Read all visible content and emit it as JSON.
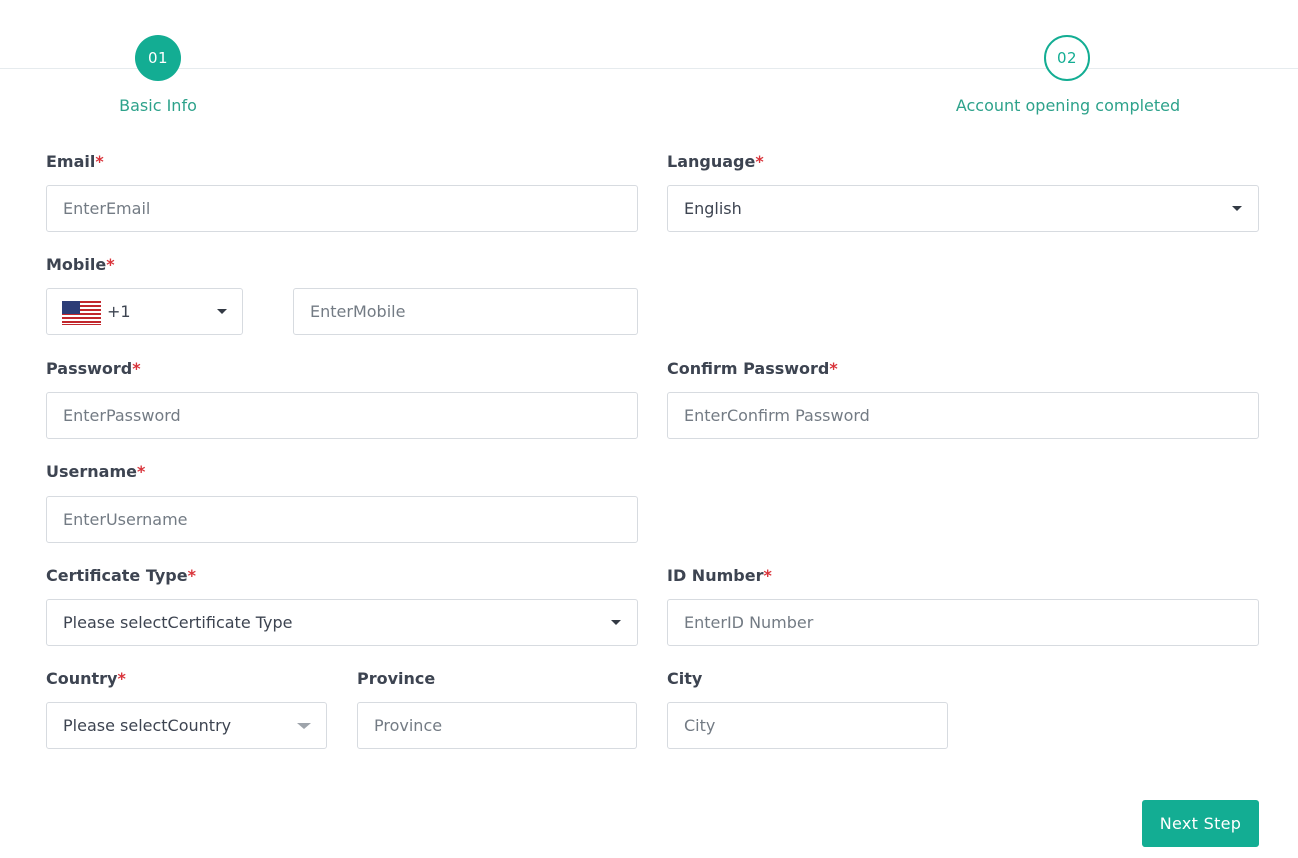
{
  "stepper": {
    "steps": [
      {
        "number": "01",
        "label": "Basic Info",
        "state": "active"
      },
      {
        "number": "02",
        "label": "Account opening completed",
        "state": "inactive"
      }
    ]
  },
  "form": {
    "required_mark": "*",
    "email": {
      "label": "Email",
      "placeholder": "EnterEmail"
    },
    "language": {
      "label": "Language",
      "value": "English"
    },
    "mobile": {
      "label": "Mobile",
      "country_code": "+1",
      "flag": "us-flag-icon",
      "placeholder": "EnterMobile"
    },
    "password": {
      "label": "Password",
      "placeholder": "EnterPassword"
    },
    "confirm_password": {
      "label": "Confirm Password",
      "placeholder": "EnterConfirm Password"
    },
    "username": {
      "label": "Username",
      "placeholder": "EnterUsername"
    },
    "certificate_type": {
      "label": "Certificate Type",
      "value": "Please selectCertificate Type"
    },
    "id_number": {
      "label": "ID Number",
      "placeholder": "EnterID Number"
    },
    "country": {
      "label": "Country",
      "value": "Please selectCountry"
    },
    "province": {
      "label": "Province",
      "placeholder": "Province"
    },
    "city": {
      "label": "City",
      "placeholder": "City"
    }
  },
  "actions": {
    "next_label": "Next Step"
  },
  "colors": {
    "accent": "#13ad93",
    "required": "#d9343b",
    "border": "#d7dbe0",
    "text": "#3d4451"
  }
}
